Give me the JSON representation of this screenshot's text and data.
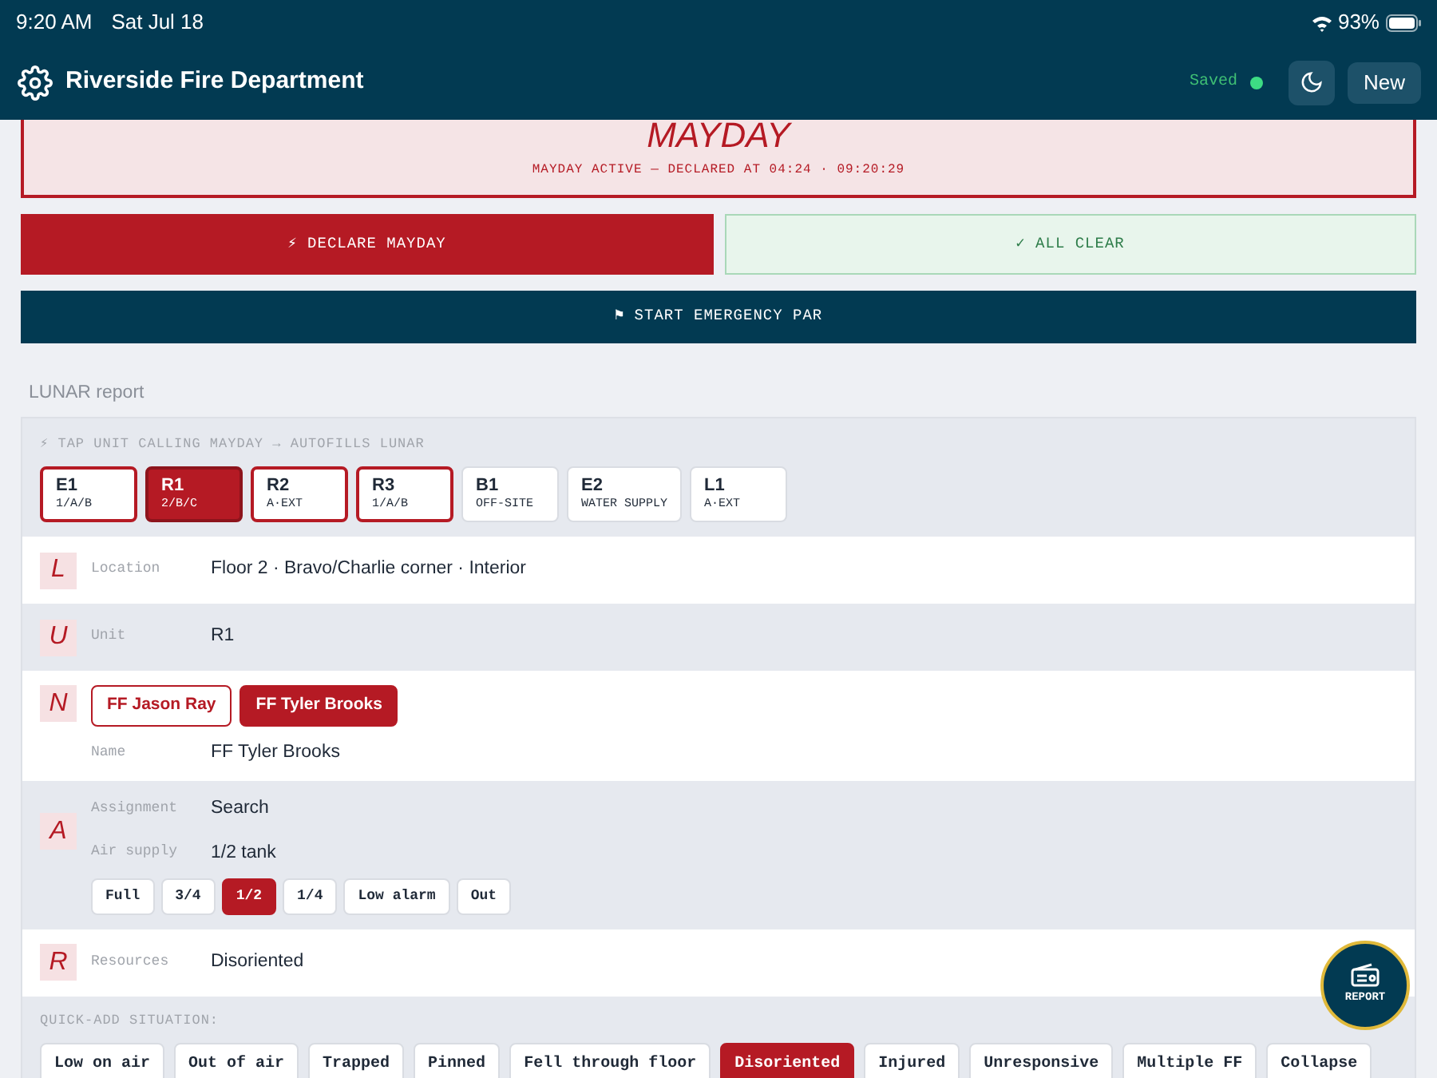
{
  "status_bar": {
    "time": "9:20 AM",
    "date": "Sat Jul 18",
    "battery": "93%"
  },
  "header": {
    "title": "Riverside Fire Department",
    "save_status": "Saved",
    "saved": true,
    "new_button": "New"
  },
  "mayday_banner": {
    "title": "MAYDAY",
    "subtitle": "MAYDAY ACTIVE — DECLARED AT 04:24 · 09:20:29"
  },
  "actions": [
    {
      "label": "⚡ DECLARE MAYDAY",
      "kind": "declare"
    },
    {
      "label": "✓ ALL CLEAR",
      "kind": "clear"
    },
    {
      "label": "⚑ START EMERGENCY PAR",
      "kind": "par"
    }
  ],
  "lunar": {
    "heading": "LUNAR report",
    "hint": "⚡ TAP UNIT CALLING MAYDAY → AUTOFILLS LUNAR",
    "units": [
      {
        "name": "E1",
        "detail": "1/A/B",
        "selected": false,
        "interior": true
      },
      {
        "name": "R1",
        "detail": "2/B/C",
        "selected": true,
        "interior": true
      },
      {
        "name": "R2",
        "detail": "A·EXT",
        "selected": false,
        "interior": true
      },
      {
        "name": "R3",
        "detail": "1/A/B",
        "selected": false,
        "interior": true
      },
      {
        "name": "B1",
        "detail": "OFF-SITE",
        "selected": false,
        "interior": false
      },
      {
        "name": "E2",
        "detail": "WATER SUPPLY",
        "selected": false,
        "interior": false
      },
      {
        "name": "L1",
        "detail": "A·EXT",
        "selected": false,
        "interior": false
      }
    ],
    "rows": [
      {
        "letter": "L",
        "fields": [
          {
            "label": "Location",
            "value": "Floor 2 · Bravo/Charlie corner · Interior"
          }
        ]
      },
      {
        "letter": "U",
        "fields": [
          {
            "label": "Unit",
            "value": "R1"
          }
        ]
      },
      {
        "letter": "N",
        "members": [
          {
            "label": "FF Jason Ray",
            "selected": false
          },
          {
            "label": "FF Tyler Brooks",
            "selected": true
          }
        ],
        "fields": [
          {
            "label": "Name",
            "value": "FF Tyler Brooks"
          }
        ]
      },
      {
        "letter": "A",
        "fields": [
          {
            "label": "Assignment",
            "value": "Search"
          },
          {
            "label": "Air supply",
            "value": "1/2 tank"
          }
        ],
        "air_options": [
          {
            "label": "Full",
            "selected": false
          },
          {
            "label": "3/4",
            "selected": false
          },
          {
            "label": "1/2",
            "selected": true
          },
          {
            "label": "1/4",
            "selected": false
          },
          {
            "label": "Low alarm",
            "selected": false
          },
          {
            "label": "Out",
            "selected": false
          }
        ]
      },
      {
        "letter": "R",
        "fields": [
          {
            "label": "Resources",
            "value": "Disoriented"
          }
        ]
      }
    ],
    "quick_add": {
      "heading": "QUICK-ADD SITUATION:",
      "options": [
        {
          "label": "Low on air",
          "selected": false
        },
        {
          "label": "Out of air",
          "selected": false
        },
        {
          "label": "Trapped",
          "selected": false
        },
        {
          "label": "Pinned",
          "selected": false
        },
        {
          "label": "Fell through floor",
          "selected": false
        },
        {
          "label": "Disoriented",
          "selected": true
        },
        {
          "label": "Injured",
          "selected": false
        },
        {
          "label": "Unresponsive",
          "selected": false
        },
        {
          "label": "Multiple FF",
          "selected": false
        },
        {
          "label": "Collapse",
          "selected": false
        }
      ]
    }
  },
  "report_button": {
    "label": "REPORT"
  }
}
